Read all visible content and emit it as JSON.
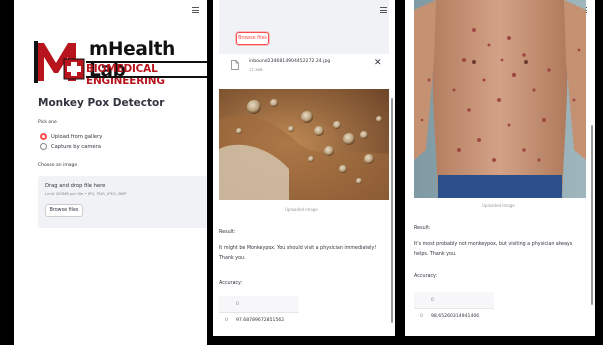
{
  "panel1": {
    "logo": {
      "title": "mHealth Lab",
      "subtitle": "BIOMEDICAL ENGINEERING"
    },
    "app_title": "Monkey Pox Detector",
    "pick_label": "Pick one",
    "options": [
      {
        "label": "Upload from gallery",
        "selected": true
      },
      {
        "label": "Capture by camera",
        "selected": false
      }
    ],
    "choose_label": "Choose an image",
    "uploader": {
      "title": "Drag and drop file here",
      "limit": "Limit 200MB per file • JPG, PNG, JPEG, BMP",
      "button": "Browse files"
    }
  },
  "panel2": {
    "browse_button": "Browse files",
    "file": {
      "name": "inbound2346814904452272 24.jpg",
      "size": "17.3KB"
    },
    "caption": "Uploaded Image",
    "result_label": "Result:",
    "result_text_1": "It might be Monkeypox. You should visit a physician immediately!",
    "result_text_2": "Thank you.",
    "accuracy_label": "Accuracy:",
    "table": {
      "header": "0",
      "index": "0",
      "value": "97.68789672851562"
    }
  },
  "panel3": {
    "caption": "Uploaded Image",
    "result_label": "Result:",
    "result_text_1": "It's most probably not monkeypox, but visiting a physician always",
    "result_text_2": "helps. Thank you.",
    "accuracy_label": "Accuracy:",
    "table": {
      "header": "0",
      "index": "0",
      "value": "98.65260314941406"
    }
  },
  "colors": {
    "accent": "#ff4b4b",
    "logo_red": "#b8141e",
    "uploader_bg": "#f0f2f6"
  },
  "icons": [
    "hamburger-menu-icon",
    "file-icon",
    "close-icon",
    "medical-cross-icon"
  ]
}
